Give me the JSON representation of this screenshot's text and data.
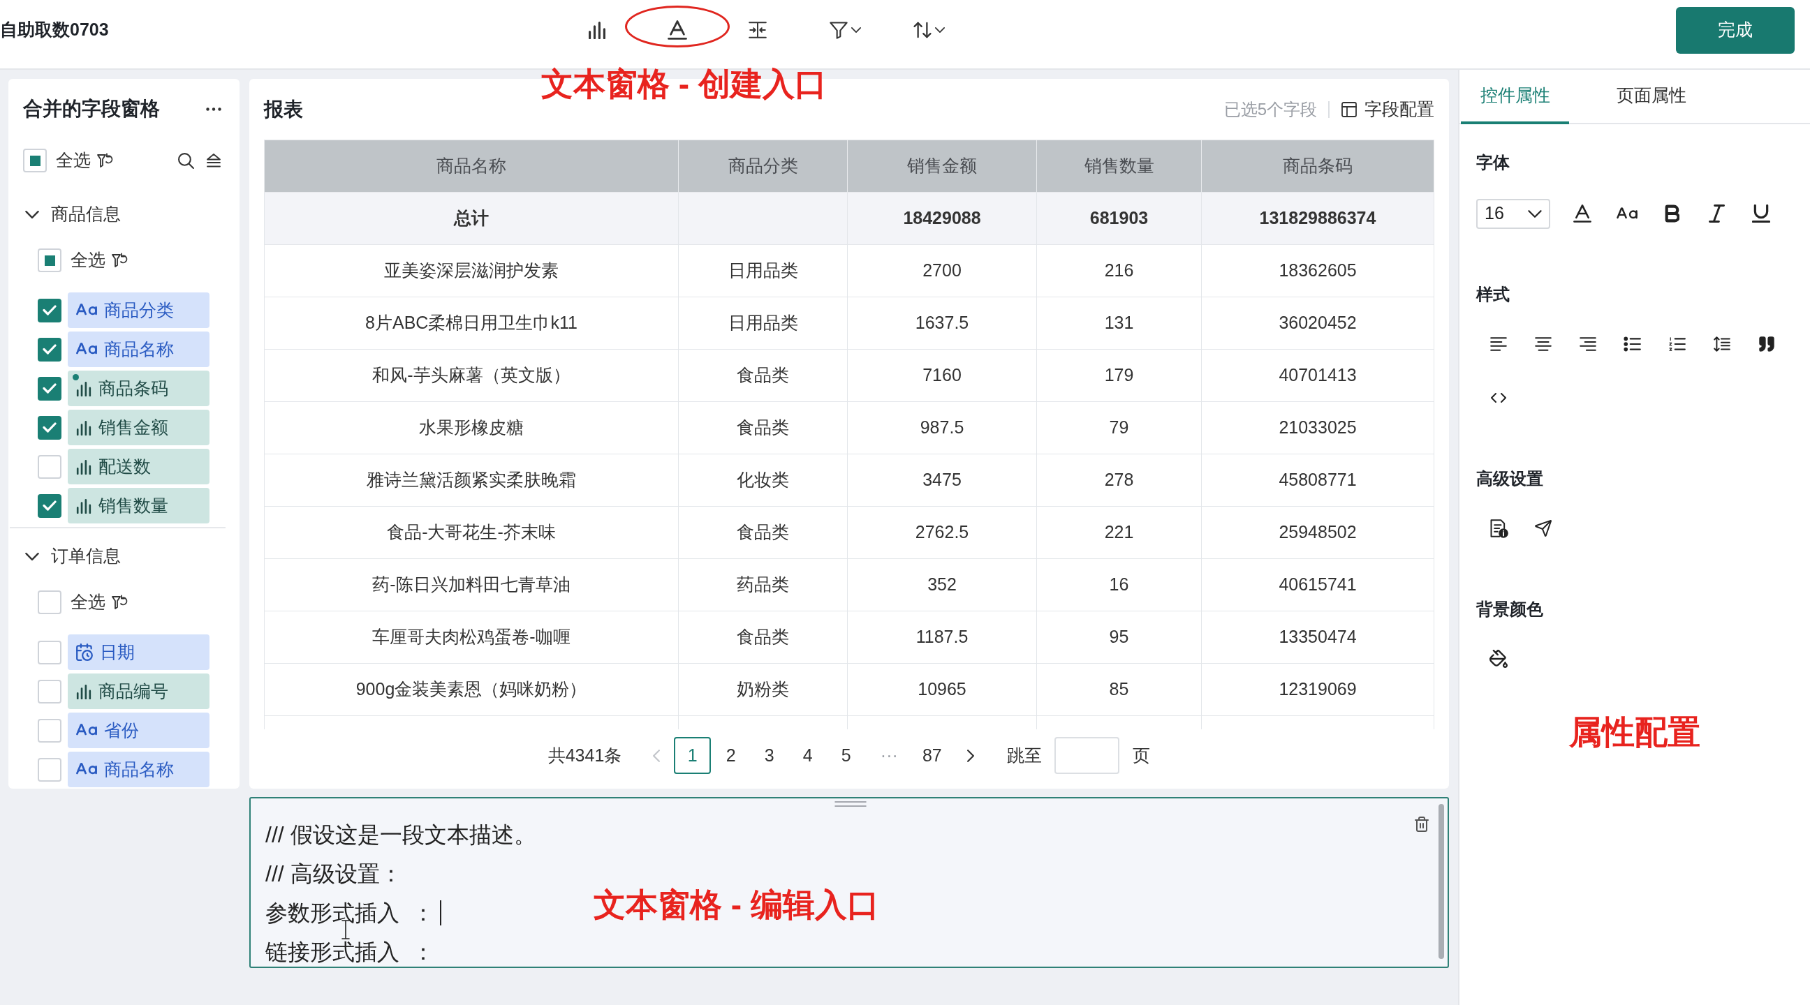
{
  "app_bar": {
    "title": "自助取数0703",
    "tools": [
      {
        "kind": "chart",
        "caret": false,
        "circled": false
      },
      {
        "kind": "text",
        "caret": false,
        "circled": true
      },
      {
        "kind": "insert",
        "caret": false,
        "circled": false
      },
      {
        "kind": "filter",
        "caret": true,
        "circled": false
      },
      {
        "kind": "sort",
        "caret": true,
        "circled": false
      }
    ],
    "done_button": "完成",
    "annotation": "文本窗格 - 创建入口"
  },
  "field_pane": {
    "title": "合并的字段窗格",
    "select_all": {
      "label": "全选",
      "indeterminate": true
    },
    "groups": [
      {
        "name": "商品信息",
        "expanded": true,
        "select_all": {
          "label": "全选",
          "indeterminate": true
        },
        "fields": [
          {
            "label": "商品分类",
            "kind": "text",
            "checked": true,
            "flagged": false
          },
          {
            "label": "商品名称",
            "kind": "text",
            "checked": true,
            "flagged": false
          },
          {
            "label": "商品条码",
            "kind": "measure",
            "checked": true,
            "flagged": true
          },
          {
            "label": "销售金额",
            "kind": "measure",
            "checked": true,
            "flagged": false
          },
          {
            "label": "配送数",
            "kind": "measure",
            "checked": false,
            "flagged": false
          },
          {
            "label": "销售数量",
            "kind": "measure",
            "checked": true,
            "flagged": false
          }
        ]
      },
      {
        "name": "订单信息",
        "expanded": true,
        "select_all": {
          "label": "全选",
          "indeterminate": false
        },
        "fields": [
          {
            "label": "日期",
            "kind": "date",
            "checked": false,
            "flagged": false
          },
          {
            "label": "商品编号",
            "kind": "measure",
            "checked": false,
            "flagged": false
          },
          {
            "label": "省份",
            "kind": "text",
            "checked": false,
            "flagged": false
          },
          {
            "label": "商品名称",
            "kind": "text",
            "checked": false,
            "flagged": false
          }
        ]
      }
    ]
  },
  "report": {
    "title": "报表",
    "selected_fields": "已选5个字段",
    "config_button": "字段配置",
    "table": {
      "columns": [
        "商品名称",
        "商品分类",
        "销售金额",
        "销售数量",
        "商品条码"
      ],
      "total_row": {
        "label": "总计",
        "sales_amount": "18429088",
        "sales_quantity": "681903",
        "barcode": "131829886374"
      },
      "rows": [
        [
          "亚美姿深层滋润护发素",
          "日用品类",
          "2700",
          "216",
          "18362605"
        ],
        [
          "8片ABC柔棉日用卫生巾k11",
          "日用品类",
          "1637.5",
          "131",
          "36020452"
        ],
        [
          "和风-芋头麻薯（英文版）",
          "食品类",
          "7160",
          "179",
          "40701413"
        ],
        [
          "水果形橡皮糖",
          "食品类",
          "987.5",
          "79",
          "21033025"
        ],
        [
          "雅诗兰黛活颜紧实柔肤晚霜",
          "化妆类",
          "3475",
          "278",
          "45808771"
        ],
        [
          "食品-大哥花生-芥末味",
          "食品类",
          "2762.5",
          "221",
          "25948502"
        ],
        [
          "药-陈日兴加料田七青草油",
          "药品类",
          "352",
          "16",
          "40615741"
        ],
        [
          "车厘哥夫肉松鸡蛋卷-咖喱",
          "食品类",
          "1187.5",
          "95",
          "13350474"
        ],
        [
          "900g金装美素恩（妈咪奶粉）",
          "奶粉类",
          "10965",
          "85",
          "12319069"
        ]
      ]
    },
    "pagination": {
      "total": "共4341条",
      "previous": {
        "disabled": true
      },
      "pages": [
        {
          "label": "1",
          "kind": "page",
          "selected": true
        },
        {
          "label": "2",
          "kind": "page",
          "selected": false
        },
        {
          "label": "3",
          "kind": "page",
          "selected": false
        },
        {
          "label": "4",
          "kind": "page",
          "selected": false
        },
        {
          "label": "5",
          "kind": "page",
          "selected": false
        },
        {
          "label": "···",
          "kind": "ellipsis",
          "selected": false
        },
        {
          "label": "87",
          "kind": "page",
          "selected": false
        }
      ],
      "next": {
        "disabled": false
      },
      "jump_label": "跳至",
      "unit": "页"
    }
  },
  "text_pane": {
    "lines": [
      {
        "text": "/// 假设这是一段文本描述。",
        "caret": false
      },
      {
        "text": "/// 高级设置：",
        "caret": false
      },
      {
        "text": "参数形式插入  ：",
        "caret": true
      },
      {
        "text": "链接形式插入  ：",
        "caret": false
      }
    ],
    "annotation": "文本窗格 - 编辑入口"
  },
  "property_panel": {
    "tabs": [
      {
        "label": "控件属性",
        "selected": true
      },
      {
        "label": "页面属性",
        "selected": false
      }
    ],
    "sections": [
      {
        "title": "字体",
        "font_size": "16",
        "tools": [
          {
            "kind": "font_color"
          },
          {
            "kind": "font_case"
          },
          {
            "kind": "bold"
          },
          {
            "kind": "italic"
          },
          {
            "kind": "underline"
          }
        ]
      },
      {
        "title": "样式",
        "tools": [
          {
            "kind": "align_left"
          },
          {
            "kind": "align_center"
          },
          {
            "kind": "align_right"
          },
          {
            "kind": "bullet_list"
          },
          {
            "kind": "numbered_list"
          },
          {
            "kind": "line_spacing"
          },
          {
            "kind": "quote"
          },
          {
            "kind": "code"
          }
        ]
      },
      {
        "title": "高级设置",
        "tools": [
          {
            "kind": "document_info"
          },
          {
            "kind": "send"
          }
        ]
      },
      {
        "title": "背景颜色",
        "tools": [
          {
            "kind": "paint_bucket"
          }
        ]
      }
    ],
    "annotation": "属性配置"
  }
}
